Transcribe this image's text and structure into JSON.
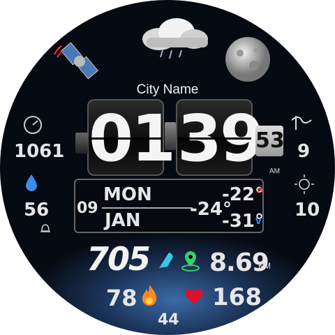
{
  "city": "City Name",
  "time": {
    "hours": "01",
    "minutes": "39",
    "seconds": "53",
    "ampm": "AM"
  },
  "date": {
    "day_number": "09",
    "weekday": "MON",
    "month": "JAN"
  },
  "weather": {
    "current_temp": "-24°",
    "high_temp": "-22°",
    "low_temp": "-31°"
  },
  "left": {
    "pressure": "1061",
    "humidity": "56"
  },
  "right": {
    "wind": "9",
    "uv": "10"
  },
  "activity": {
    "steps": "705",
    "distance": "8.69",
    "distance_unit": "KM",
    "calories": "78",
    "heart_rate": "168",
    "bottom_value": "44"
  },
  "colors": {
    "accent_red": "#ff3030",
    "accent_blue": "#2d8cff",
    "steps_cyan": "#39c6e8",
    "location_green": "#39d06a",
    "heart_red": "#e0102a",
    "flame_orange": "#ff8a1c"
  }
}
